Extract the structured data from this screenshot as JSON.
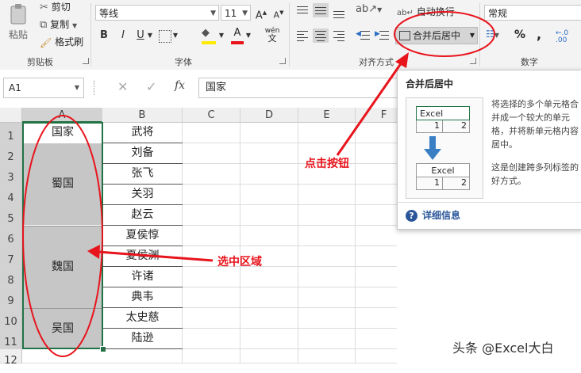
{
  "clipboard": {
    "paste": "粘贴",
    "cut": "剪切",
    "copy": "复制",
    "format_painter": "格式刷",
    "group": "剪贴板"
  },
  "font": {
    "name": "等线",
    "size": "11",
    "grow": "A",
    "shrink": "A",
    "bold": "B",
    "italic": "I",
    "underline": "U",
    "font_color": "A",
    "wen": "wén",
    "group": "字体"
  },
  "alignment": {
    "wrap": "自动换行",
    "merge": "合并后居中",
    "group": "对齐方式"
  },
  "number": {
    "format": "常规",
    "percent": "%",
    "comma": ",",
    "group": "数字"
  },
  "formula_bar": {
    "name_box": "A1",
    "fx": "fx",
    "content": "国家"
  },
  "columns": [
    "A",
    "B",
    "C",
    "D",
    "E",
    "F"
  ],
  "rows": [
    "1",
    "2",
    "3",
    "4",
    "5",
    "6",
    "7",
    "8",
    "9",
    "10",
    "11",
    "12"
  ],
  "colA": {
    "a1": "国家",
    "merged": [
      "蜀国",
      "魏国",
      "吴国"
    ]
  },
  "colB": [
    "武将",
    "刘备",
    "张飞",
    "关羽",
    "赵云",
    "夏侯惇",
    "夏侯渊",
    "许诸",
    "典韦",
    "太史慈",
    "陆逊"
  ],
  "tooltip": {
    "title": "合并后居中",
    "demo_top": "Excel",
    "demo_bottom": "Excel",
    "n1": "1",
    "n2": "2",
    "n3": "1",
    "n4": "2",
    "desc1": [
      "将选择的多个单元格合",
      "并成一个较大的单元",
      "格，并将新单元格内容",
      "居中。"
    ],
    "desc2": [
      "这是创建跨多列标签的",
      "好方式。"
    ],
    "more": "详细信息"
  },
  "annotations": {
    "click": "点击按钮",
    "select": "选中区域"
  },
  "watermark": "头条 @Excel大白",
  "colors": {
    "accent_red": "#e8141c",
    "excel_green": "#217346",
    "selection_fill": "#c6c6c6"
  }
}
